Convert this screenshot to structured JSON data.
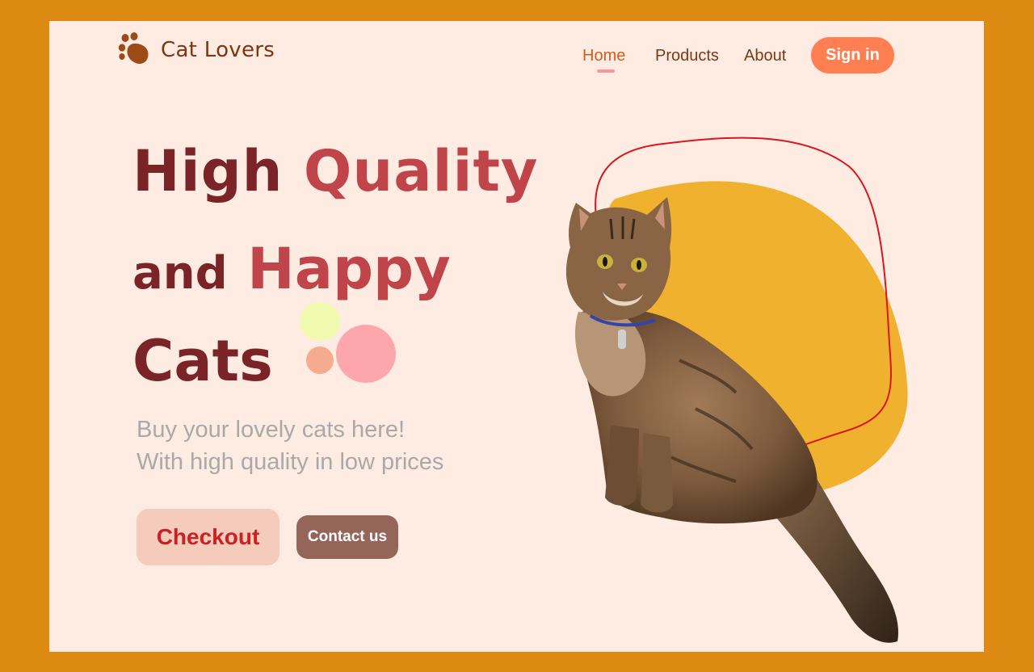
{
  "brand": {
    "name": "Cat Lovers",
    "icon": "paw-icon"
  },
  "nav": {
    "items": [
      {
        "label": "Home",
        "active": true
      },
      {
        "label": "Products",
        "active": false
      },
      {
        "label": "About",
        "active": false
      }
    ],
    "signin_label": "Sign in"
  },
  "hero": {
    "line1_dark": "High",
    "line1_accent": "Quality",
    "line2_dark": "and",
    "line2_accent": "Happy",
    "line3_dark": "Cats",
    "subtitle_line1": "Buy your lovely cats here!",
    "subtitle_line2": "With high quality in low prices"
  },
  "buttons": {
    "checkout_label": "Checkout",
    "contact_label": "Contact us"
  },
  "colors": {
    "frame": "#dd8a12",
    "page_bg": "#feebe1",
    "brand_text": "#7e3510",
    "nav_active": "#d35e1c",
    "signin_bg": "#ff7f53",
    "headline_dark": "#7a2428",
    "headline_accent": "#c0454b",
    "subtitle": "#a9a9aa",
    "checkout_bg": "#f5ccbb",
    "checkout_text": "#cc2024",
    "contact_bg": "#96655a",
    "blob_yellow": "#f0b12e",
    "outline_red": "#d9161f"
  }
}
